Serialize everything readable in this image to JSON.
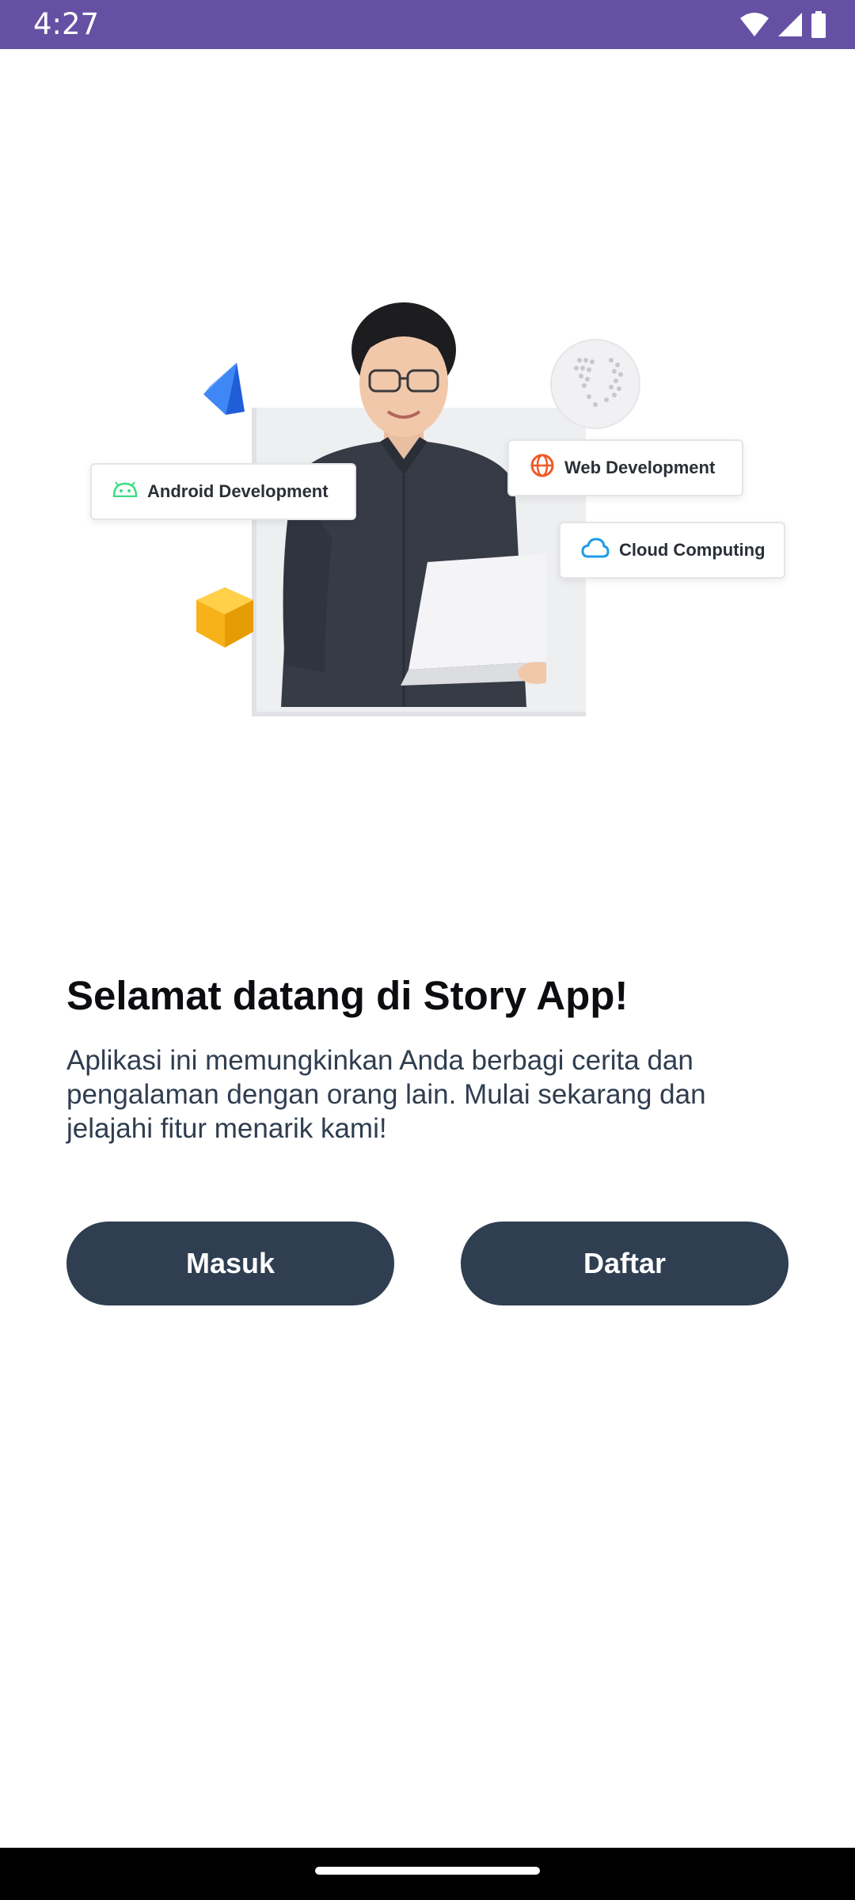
{
  "status_bar": {
    "time": "4:27",
    "icons": [
      "wifi-icon",
      "cellular-signal-icon",
      "battery-icon"
    ],
    "background": "#6650a4"
  },
  "hero": {
    "chips": {
      "android": {
        "label": "Android Development",
        "icon": "android-icon",
        "color": "#3ddc84"
      },
      "web": {
        "label": "Web Development",
        "icon": "globe-icon",
        "color": "#f05a28"
      },
      "cloud": {
        "label": "Cloud Computing",
        "icon": "cloud-icon",
        "color": "#1e9be9"
      }
    },
    "decorations": [
      "blue-crystal",
      "yellow-cube",
      "world-globe"
    ]
  },
  "welcome": {
    "title": "Selamat datang di Story App!",
    "description": "Aplikasi ini memungkinkan Anda berbagi cerita dan pengalaman dengan orang lain. Mulai sekarang dan jelajahi fitur menarik kami!"
  },
  "actions": {
    "login_label": "Masuk",
    "register_label": "Daftar",
    "button_color": "#2f3e51"
  }
}
